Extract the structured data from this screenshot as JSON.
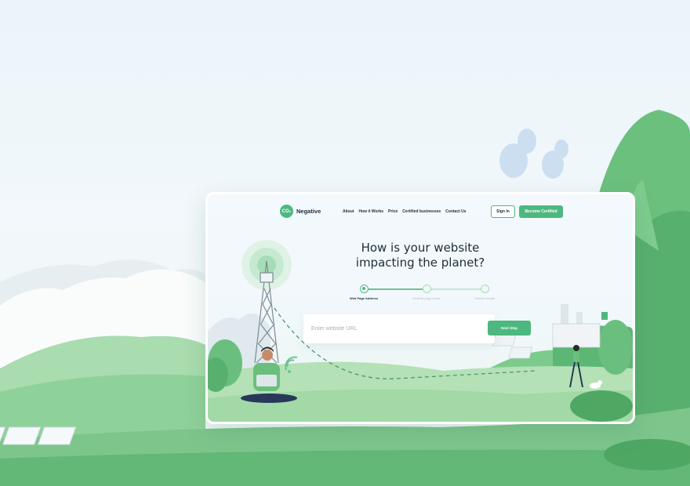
{
  "brand": {
    "logo_mark": "CO₂",
    "name": "Negative"
  },
  "nav": {
    "links": [
      "About",
      "How it Works",
      "Price",
      "Certified businesses",
      "Contact Us"
    ],
    "signin_label": "Sign In",
    "certified_label": "Become Certified"
  },
  "hero": {
    "line1": "How is your website",
    "line2": "impacting the planet?"
  },
  "steps": [
    {
      "label": "Web Page Address",
      "active": true
    },
    {
      "label": "Monthly page views",
      "active": false
    },
    {
      "label": "Carbon results",
      "active": false
    }
  ],
  "form": {
    "url_placeholder": "Enter website URL",
    "url_value": "",
    "next_label": "Next Step"
  },
  "colors": {
    "accent": "#4cb880",
    "text": "#1f2d3a",
    "muted": "#a5b0b8"
  },
  "icons": [
    "cell-tower-icon",
    "wifi-signal-icon",
    "solar-panel-icon",
    "factory-icon"
  ]
}
